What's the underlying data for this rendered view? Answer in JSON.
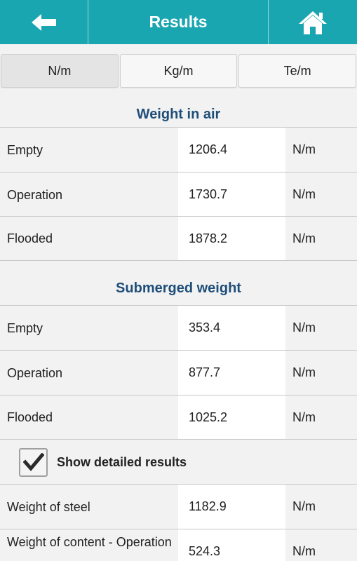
{
  "header": {
    "title": "Results",
    "back_icon": "arrow-left-icon",
    "home_icon": "home-icon",
    "bg_color": "#1aa6b1"
  },
  "unit_tabs": [
    {
      "label": "N/m",
      "selected": true
    },
    {
      "label": "Kg/m",
      "selected": false
    },
    {
      "label": "Te/m",
      "selected": false
    }
  ],
  "weight_in_air": {
    "title": "Weight in air",
    "rows": [
      {
        "label": "Empty",
        "value": "1206.4",
        "unit": "N/m"
      },
      {
        "label": "Operation",
        "value": "1730.7",
        "unit": "N/m"
      },
      {
        "label": "Flooded",
        "value": "1878.2",
        "unit": "N/m"
      }
    ]
  },
  "submerged_weight": {
    "title": "Submerged weight",
    "rows": [
      {
        "label": "Empty",
        "value": "353.4",
        "unit": "N/m"
      },
      {
        "label": "Operation",
        "value": "877.7",
        "unit": "N/m"
      },
      {
        "label": "Flooded",
        "value": "1025.2",
        "unit": "N/m"
      }
    ]
  },
  "detailed": {
    "checkbox_label": "Show detailed results",
    "checked": true,
    "rows": [
      {
        "label": "Weight of steel",
        "value": "1182.9",
        "unit": "N/m"
      },
      {
        "label": "Weight of content - Operation",
        "value": "524.3",
        "unit": "N/m"
      }
    ]
  },
  "colors": {
    "accent": "#1aa6b1",
    "section_title": "#1f4e79"
  }
}
